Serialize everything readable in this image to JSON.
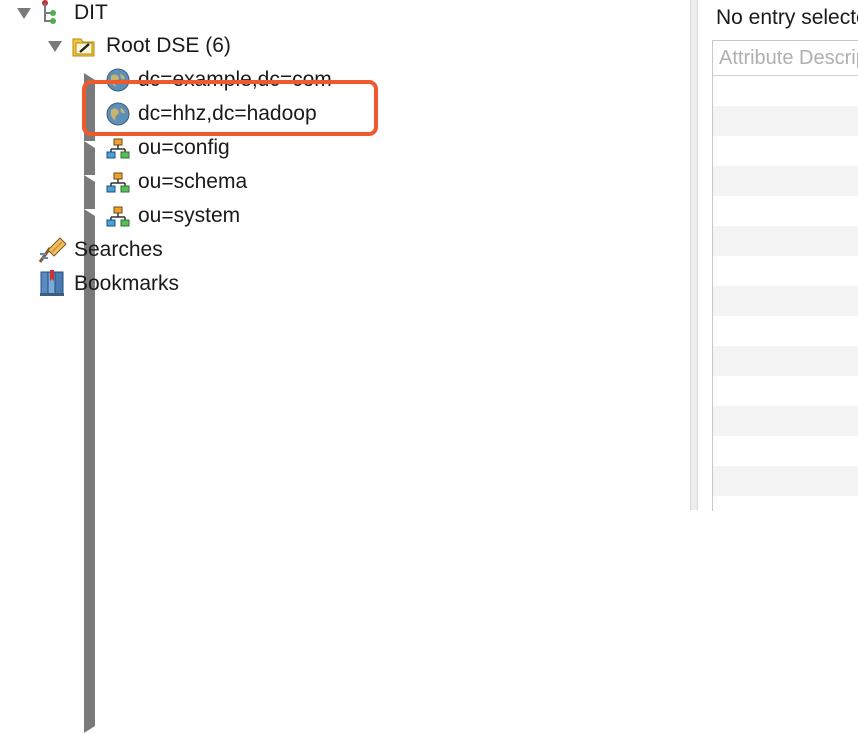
{
  "tree": {
    "dit_label": "DIT",
    "root_label": "Root DSE (6)",
    "entries": [
      {
        "label": "dc=example,dc=com",
        "icon": "globe-icon"
      },
      {
        "label": "dc=hhz,dc=hadoop",
        "icon": "globe-icon"
      },
      {
        "label": "ou=config",
        "icon": "org-tree-icon"
      },
      {
        "label": "ou=schema",
        "icon": "org-tree-icon"
      },
      {
        "label": "ou=system",
        "icon": "org-tree-icon"
      }
    ],
    "searches_label": "Searches",
    "bookmarks_label": "Bookmarks",
    "highlight_color": "#ef5a2c"
  },
  "details": {
    "status_text": "No entry selected",
    "column_header": "Attribute Description"
  }
}
